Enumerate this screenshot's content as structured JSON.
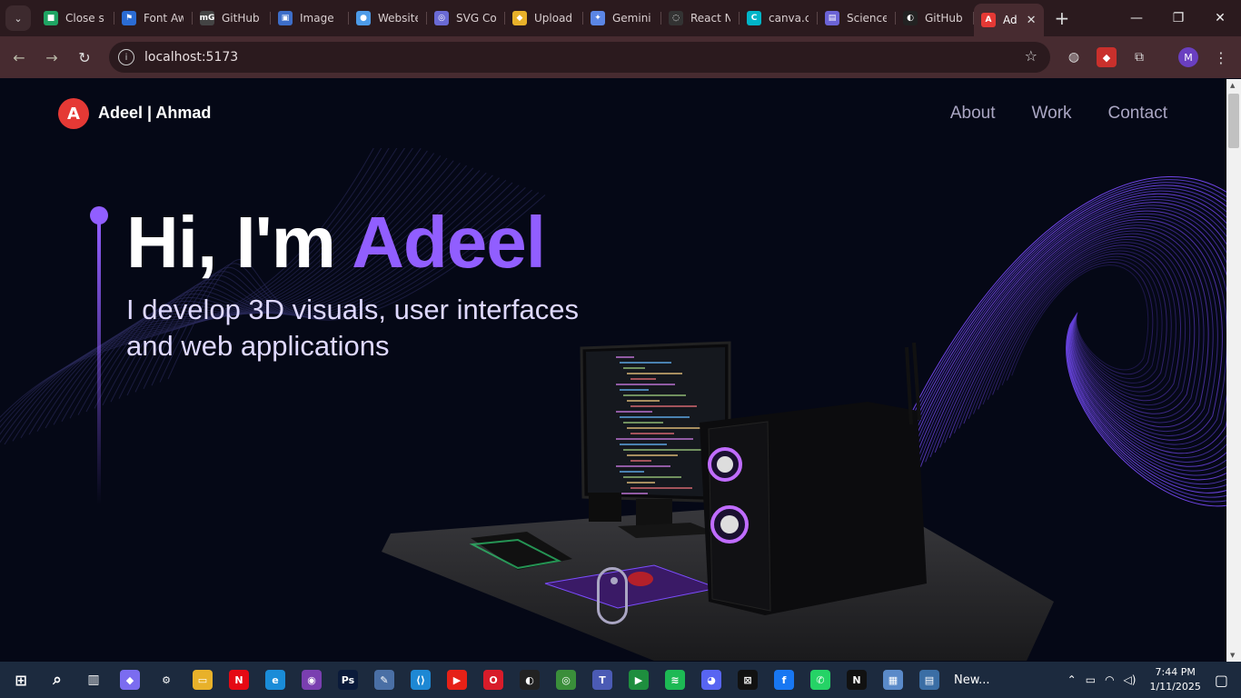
{
  "browser": {
    "tabs": [
      {
        "label": "Close s",
        "color": "#1fa463",
        "glyph": "■"
      },
      {
        "label": "Font Aw",
        "color": "#2b6cd4",
        "glyph": "⚑"
      },
      {
        "label": "GitHub",
        "color": "#444444",
        "glyph": "mG"
      },
      {
        "label": "Image",
        "color": "#3d6ec9",
        "glyph": "▣"
      },
      {
        "label": "Website",
        "color": "#4d9be8",
        "glyph": "●"
      },
      {
        "label": "SVG Co",
        "color": "#6a6ad4",
        "glyph": "◎"
      },
      {
        "label": "Upload",
        "color": "#e8b12a",
        "glyph": "◆"
      },
      {
        "label": "Gemini",
        "color": "#5b86e5",
        "glyph": "✦"
      },
      {
        "label": "React N",
        "color": "#333333",
        "glyph": "◌"
      },
      {
        "label": "canva.c",
        "color": "#00b5c8",
        "glyph": "C"
      },
      {
        "label": "Science",
        "color": "#6b63d6",
        "glyph": "▤"
      },
      {
        "label": "GitHub",
        "color": "#222222",
        "glyph": "◐"
      }
    ],
    "active_tab": {
      "label": "Ad",
      "color": "#e53935",
      "glyph": "A"
    },
    "url": "localhost:5173"
  },
  "site": {
    "brand": "Adeel | Ahmad",
    "logo_letter": "A",
    "nav": [
      "About",
      "Work",
      "Contact"
    ],
    "hero_greeting": "Hi, I'm ",
    "hero_name": "Adeel",
    "hero_subtitle": "I develop 3D visuals, user interfaces and web applications",
    "accent_color": "#915eff"
  },
  "taskbar": {
    "apps": [
      {
        "name": "copilot-icon",
        "color": "#7b6cf0",
        "glyph": "◆"
      },
      {
        "name": "settings-icon",
        "color": "transparent",
        "glyph": "⚙"
      },
      {
        "name": "file-explorer-icon",
        "color": "#e8b12a",
        "glyph": "▭"
      },
      {
        "name": "netflix-icon",
        "color": "#e50914",
        "glyph": "N"
      },
      {
        "name": "edge-icon",
        "color": "#1a8cd8",
        "glyph": "e"
      },
      {
        "name": "github-desktop-icon",
        "color": "#7a3fb0",
        "glyph": "◉"
      },
      {
        "name": "photoshop-icon",
        "color": "#0a1a3a",
        "glyph": "Ps"
      },
      {
        "name": "paint-icon",
        "color": "#4a6fa5",
        "glyph": "✎"
      },
      {
        "name": "vscode-icon",
        "color": "#1e88d4",
        "glyph": "⟨⟩"
      },
      {
        "name": "youtube-icon",
        "color": "#e62117",
        "glyph": "▶"
      },
      {
        "name": "opera-icon",
        "color": "#d81c2a",
        "glyph": "O"
      },
      {
        "name": "github-icon",
        "color": "#222",
        "glyph": "◐"
      },
      {
        "name": "chrome-icon",
        "color": "#3a8e3a",
        "glyph": "◎"
      },
      {
        "name": "teams-icon",
        "color": "#4b5bb5",
        "glyph": "T"
      },
      {
        "name": "meet-icon",
        "color": "#1e8e3e",
        "glyph": "▶"
      },
      {
        "name": "spotify-icon",
        "color": "#1db954",
        "glyph": "≋"
      },
      {
        "name": "discord-icon",
        "color": "#5865f2",
        "glyph": "◕"
      },
      {
        "name": "capcut-icon",
        "color": "#111",
        "glyph": "⊠"
      },
      {
        "name": "facebook-icon",
        "color": "#1877f2",
        "glyph": "f"
      },
      {
        "name": "whatsapp-icon",
        "color": "#25d366",
        "glyph": "✆"
      },
      {
        "name": "netflix2-icon",
        "color": "#111",
        "glyph": "N"
      },
      {
        "name": "photos-icon",
        "color": "#5a8ac9",
        "glyph": "▦"
      },
      {
        "name": "news-icon",
        "color": "#3b6ea5",
        "glyph": "▤"
      }
    ],
    "news_label": "New...",
    "time": "7:44 PM",
    "date": "1/11/2025"
  }
}
